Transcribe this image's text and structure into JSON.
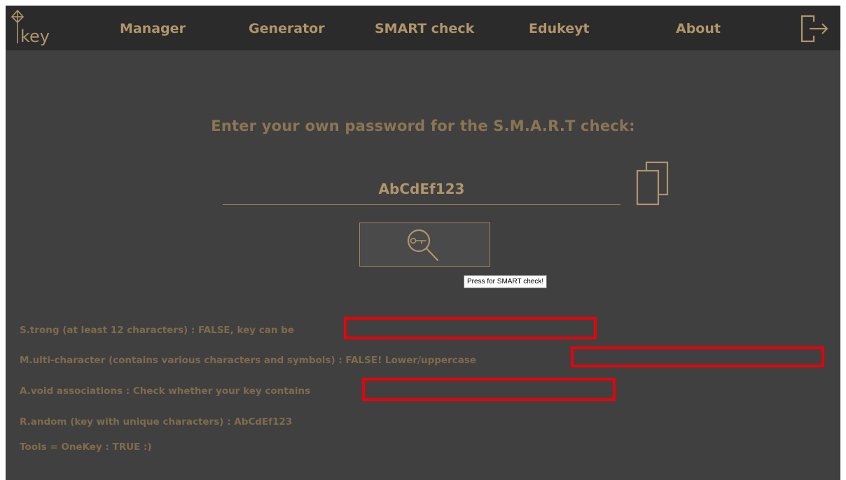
{
  "nav": {
    "logo_text": "key",
    "items": [
      {
        "label": "Manager"
      },
      {
        "label": "Generator"
      },
      {
        "label": "SMART check"
      },
      {
        "label": "Edukeyt"
      },
      {
        "label": "About"
      }
    ]
  },
  "main": {
    "prompt": "Enter your own password for the S.M.A.R.T check:",
    "password_value": "AbCdEf123",
    "tooltip": "Press for SMART check!"
  },
  "results": {
    "s": "S.trong (at least 12 characters) : FALSE, key can be",
    "m": "M.ulti-character (contains various characters and symbols) : FALSE! Lower/uppercase",
    "a": "A.void associations : Check whether your key contains",
    "r": "R.andom (key with unique characters) : AbCdEf123",
    "t": "Tools = OneKey : TRUE :)",
    "redacted_placeholder": "..."
  },
  "colors": {
    "background": "#404040",
    "navbar": "#2b2b2b",
    "accent": "#b0956a",
    "result_text": "#806b4c",
    "redaction": "#e8000a"
  },
  "icons": {
    "logo": "key-logo-icon",
    "logout": "logout-icon",
    "copy": "copy-icon",
    "search": "magnifier-key-icon"
  }
}
